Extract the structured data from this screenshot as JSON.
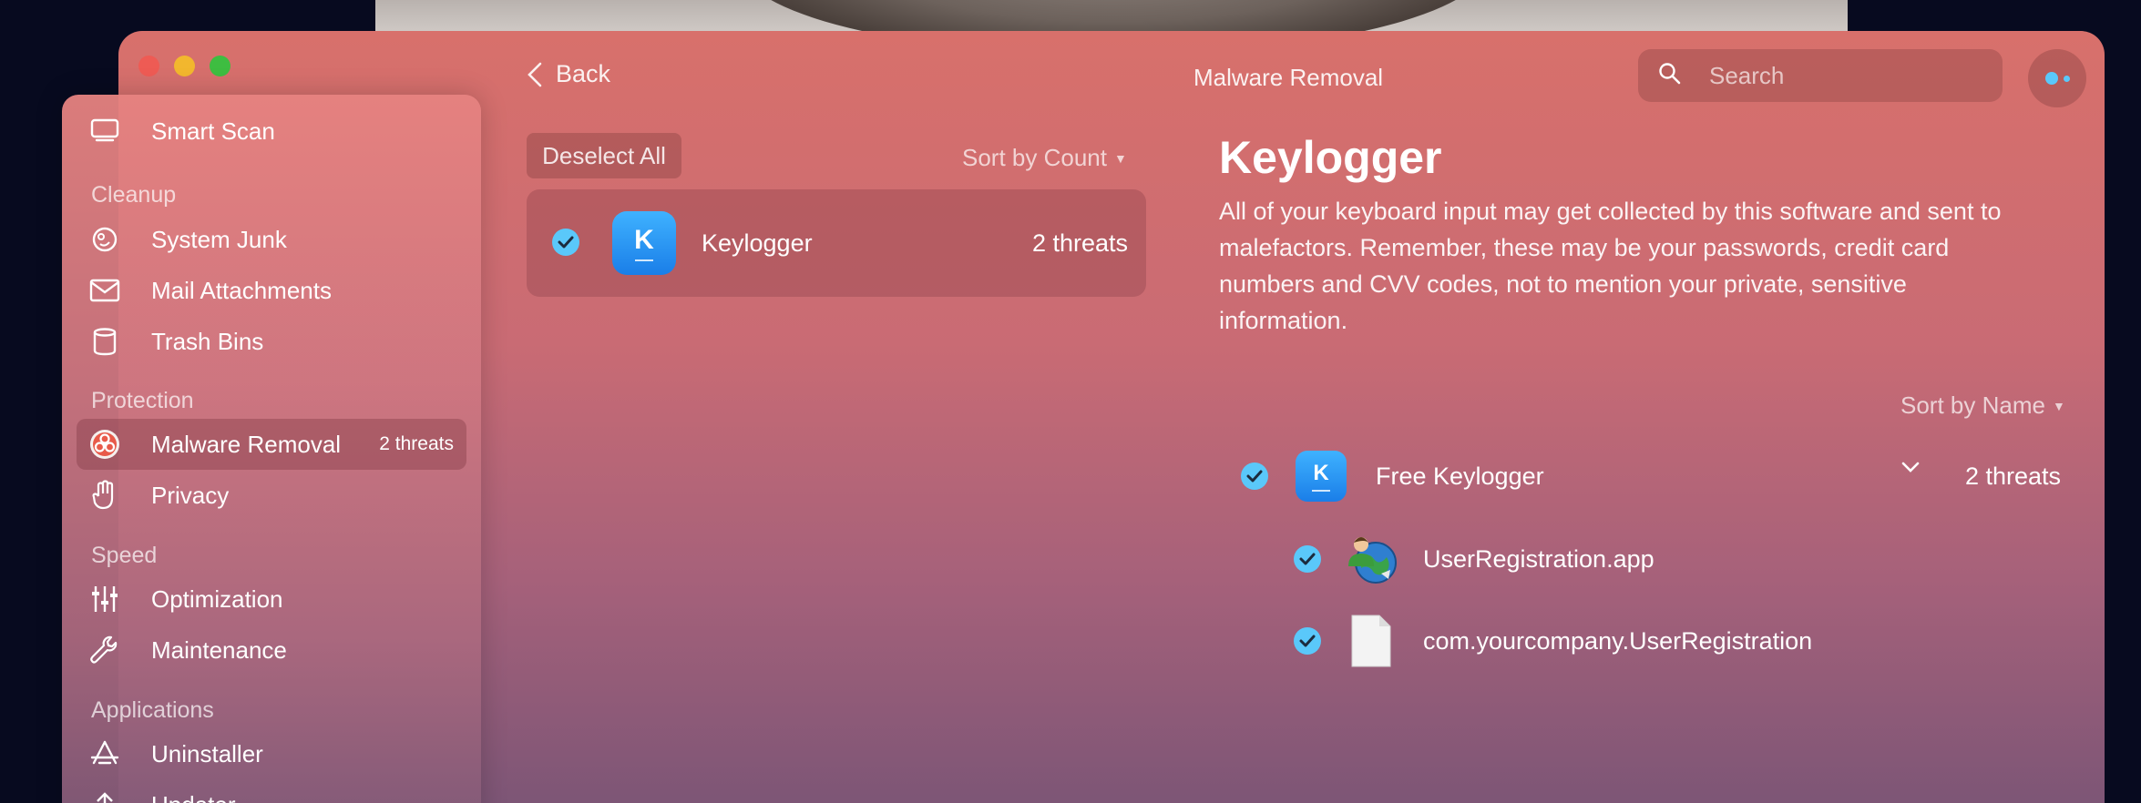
{
  "window": {
    "title": "Malware Removal"
  },
  "nav": {
    "back_label": "Back"
  },
  "search": {
    "placeholder": "Search"
  },
  "sidebar": {
    "smart_scan": "Smart Scan",
    "sections": {
      "cleanup": "Cleanup",
      "protection": "Protection",
      "speed": "Speed",
      "applications": "Applications"
    },
    "items": {
      "system_junk": "System Junk",
      "mail_attachments": "Mail Attachments",
      "trash_bins": "Trash Bins",
      "malware_removal": "Malware Removal",
      "malware_count": "2 threats",
      "privacy": "Privacy",
      "optimization": "Optimization",
      "maintenance": "Maintenance",
      "uninstaller": "Uninstaller",
      "updater": "Updater"
    }
  },
  "list": {
    "deselect_label": "Deselect All",
    "sort_label": "Sort by Count",
    "threats": [
      {
        "name": "Keylogger",
        "count": "2 threats",
        "icon_letter": "K"
      }
    ]
  },
  "detail": {
    "title": "Keylogger",
    "description": "All of your keyboard input may get collected by this software and sent to malefactors. Remember, these may be your passwords, credit card numbers and CVV codes, not to mention your private, sensitive information.",
    "sort_label": "Sort by Name",
    "app": {
      "name": "Free Keylogger",
      "count": "2 threats",
      "icon_letter": "K"
    },
    "files": [
      {
        "name": "UserRegistration.app",
        "icon": "globe-person-icon"
      },
      {
        "name": "com.yourcompany.UserRegistration",
        "icon": "document-icon"
      }
    ]
  },
  "colors": {
    "accent_check": "#5ac8fa",
    "close": "#ee5b54",
    "minimize": "#f2b72e",
    "zoom": "#3ebd41"
  }
}
